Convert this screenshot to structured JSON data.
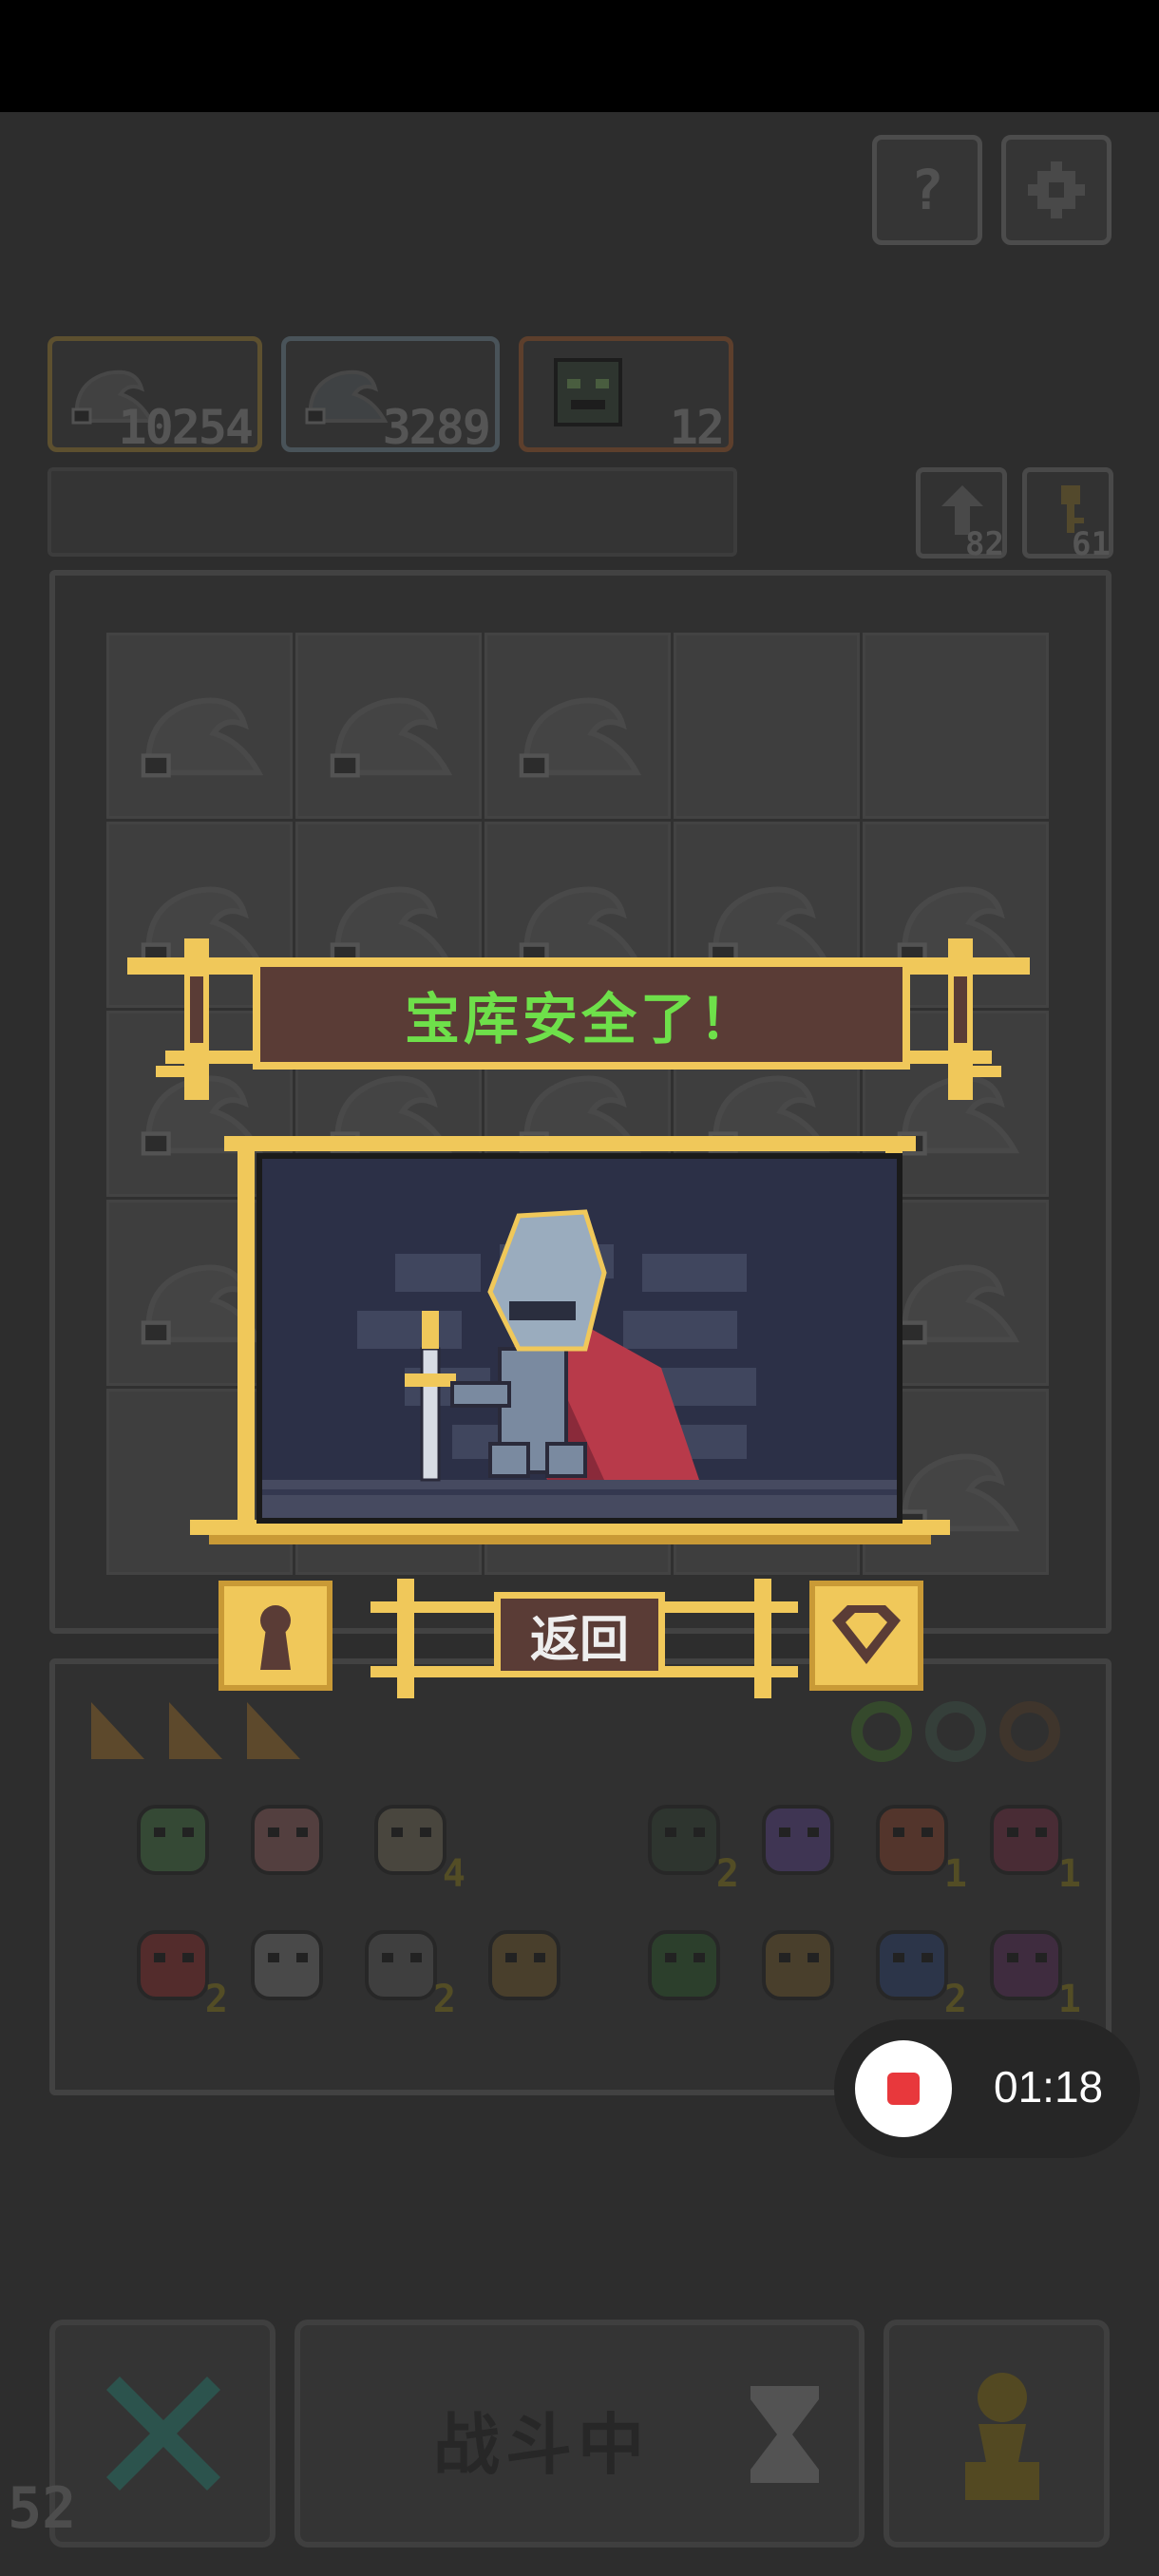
{
  "hud": {
    "help_icon": "question-icon",
    "settings_icon": "gear-icon",
    "resources": [
      {
        "icon": "gray-coin-pile-icon",
        "value": "10254",
        "border": "#8a7440"
      },
      {
        "icon": "blue-coin-pile-icon",
        "value": "3289",
        "border": "#6a7a84"
      },
      {
        "icon": "monster-chest-icon",
        "value": "12",
        "border": "#8a5a3a"
      }
    ],
    "small_resources": [
      {
        "icon": "arrow-icon",
        "value": "82"
      },
      {
        "icon": "key-icon",
        "value": "61"
      }
    ]
  },
  "inventory": {
    "items_row1": [
      {
        "icon": "green-helmet-icon",
        "count": ""
      },
      {
        "icon": "axe-icon",
        "count": ""
      },
      {
        "icon": "scroll-icon",
        "count": "4"
      },
      {
        "icon": "green-mask-icon",
        "count": "2"
      },
      {
        "icon": "purple-bat-icon",
        "count": ""
      },
      {
        "icon": "orange-golem-icon",
        "count": "1"
      },
      {
        "icon": "red-wizard-icon",
        "count": "1"
      }
    ],
    "items_row2": [
      {
        "icon": "red-slime-icon",
        "count": "2"
      },
      {
        "icon": "dagger-icon",
        "count": ""
      },
      {
        "icon": "spellbook-icon",
        "count": "2"
      },
      {
        "icon": "shovel-icon",
        "count": ""
      },
      {
        "icon": "green-plant-icon",
        "count": ""
      },
      {
        "icon": "spike-trap-icon",
        "count": ""
      },
      {
        "icon": "hourglass-icon",
        "count": "2"
      },
      {
        "icon": "purple-demon-icon",
        "count": "1"
      }
    ]
  },
  "bottom": {
    "battle_label": "战斗中",
    "close_icon": "x-icon",
    "hourglass_icon": "hourglass-icon",
    "pawn_icon": "pawn-icon"
  },
  "fps": "52",
  "modal": {
    "title": "宝库安全了！",
    "back_label": "返回",
    "left_icon": "keyhole-icon",
    "right_icon": "gem-icon"
  },
  "recording": {
    "time": "01:18"
  }
}
